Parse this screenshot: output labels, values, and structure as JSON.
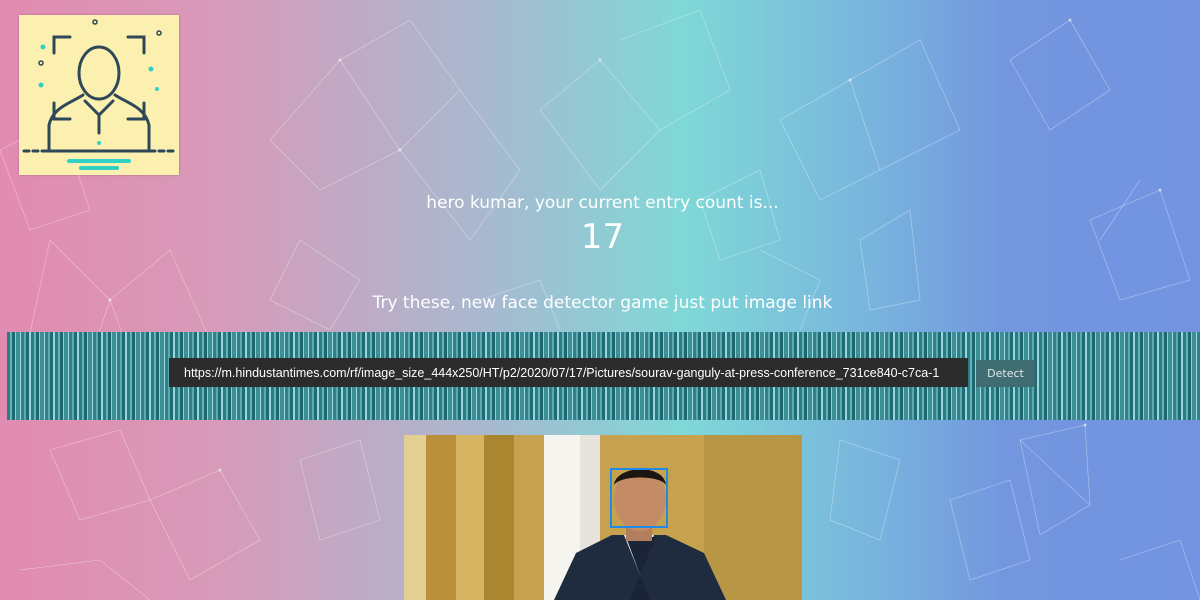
{
  "header": {
    "logo_icon": "face-recognition-icon",
    "greeting": "hero kumar, your current entry count is...",
    "entry_count": "17",
    "tagline": "Try these, new face detector game just put image link"
  },
  "detector": {
    "url_value": "https://m.hindustantimes.com/rf/image_size_444x250/HT/p2/2020/07/17/Pictures/sourav-ganguly-at-press-conference_731ce840-c7ca-1",
    "detect_label": "Detect"
  },
  "result": {
    "image_icon": "detected-photo",
    "face_box_color": "#1e8ce6"
  },
  "colors": {
    "bg_left": "#e28bb0",
    "bg_mid": "#7fd8d7",
    "bg_right": "#7393e0",
    "input_bg": "#2c2c2c",
    "button_bg": "#3f6d72"
  }
}
